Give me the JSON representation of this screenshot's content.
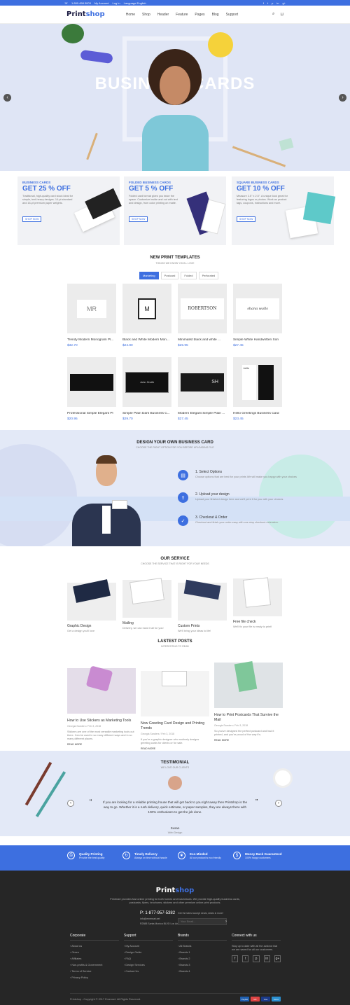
{
  "topbar": {
    "phone": "1.800.458.3003",
    "account": "My Account",
    "login": "Log In",
    "language": "Language English",
    "socials": [
      "f",
      "t",
      "p",
      "in",
      "g+"
    ]
  },
  "nav": {
    "logo_a": "Print",
    "logo_b": "shop",
    "menu": [
      "Home",
      "Shop",
      "Header",
      "Feature",
      "Pages",
      "Blog",
      "Support"
    ]
  },
  "hero": {
    "title": "BUSINESS CARDS"
  },
  "promos": [
    {
      "kicker": "BUSINESS CARDS",
      "headline": "GET 25 % OFF",
      "desc": "Traditional, high-quality card stock ideal for simple, text-heavy designs. 14-pt standard and 16-pt premium paper weights.",
      "button": "SHOP NOW"
    },
    {
      "kicker": "FOLDED BUSINESS CARDS",
      "headline": "GET 5 % OFF",
      "desc": "Folded card format gives you twice the space. Customize inside and out with text and design, from color printing on matte.",
      "button": "SHOP NOW"
    },
    {
      "kicker": "SQUARE BUSINESS CARDS",
      "headline": "GET 10 % OFF",
      "desc": "Measure 2.5\" x 2.5\". A unique look great for featuring logos or photos. Work as product tags, coupons, instructions and more.",
      "button": "SHOP NOW"
    }
  ],
  "templates": {
    "title": "NEW PRINT TEMPLATES",
    "subtitle": "THINGS WE KNOW YOU'LL LOVE",
    "tabs": [
      "Marketing",
      "Postcard",
      "Folded",
      "Perforated"
    ],
    "items": [
      {
        "name": "Trendy Modern Monogram Pl...",
        "price": "$32.70",
        "logo": "MR"
      },
      {
        "name": "Black and White Modern Mon...",
        "price": "$24.80",
        "logo": "M"
      },
      {
        "name": "Minimalist black and white ...",
        "price": "$25.95",
        "logo": "ROBERTSON"
      },
      {
        "name": "Simple White Handwritten Son",
        "price": "$27.45",
        "logo": "shana walls"
      },
      {
        "name": "Professional Simple Elegant Pl",
        "price": "$20.95",
        "logo": ""
      },
      {
        "name": "Simple Plain Dark Business C...",
        "price": "$29.70",
        "logo": "John Smith"
      },
      {
        "name": "Modern Elegant Simple Plain ...",
        "price": "$27.45",
        "logo": "SH"
      },
      {
        "name": "Hello Greetings Business Card",
        "price": "$23.45",
        "logo": "hello"
      }
    ]
  },
  "design": {
    "title": "DESIGN YOUR OWN BUSINESS CARD",
    "subtitle": "CHOOSE THE RIGHT OPTION FOR YOU BEFORE UPLOADING FILE",
    "steps": [
      {
        "title": "1. Select Options",
        "desc": "Choose options that are best for your prints We will make you happy with your choices"
      },
      {
        "title": "2. Upload your design",
        "desc": "Upload your finished design here and we'll print it for you with your choices"
      },
      {
        "title": "3. Checkout & Order",
        "desc": "Checkout and finish your order easy with one stop checkout extension."
      }
    ]
  },
  "service": {
    "title": "OUR SERVICE",
    "subtitle": "CHOOSE THE SERVICE THAT IS RIGHT FOR YOUR NEEDS",
    "items": [
      {
        "title": "Graphic Design",
        "desc": "Get a design you'll love"
      },
      {
        "title": "Mailing",
        "desc": "Delivery, we can hand it all for you!"
      },
      {
        "title": "Custom Prints",
        "desc": "We'll bring your ideas to life!"
      },
      {
        "title": "Free file check",
        "desc": "We'll fix your file is ready to print!"
      }
    ]
  },
  "posts": {
    "title": "LASTEST POSTS",
    "subtitle": "INTERESTING TO READ",
    "items": [
      {
        "title": "How to Use Stickers as Marketing Tools",
        "meta": "Georgia Sanders / Feb 3, 2018",
        "desc": "Stickers are one of the most versatile marketing tools out there. Can be used in so many different ways and in so many different places.",
        "more": "READ MORE"
      },
      {
        "title": "Now Greeting Card Design and Printing Trends",
        "meta": "Georgia Sanders / Feb 3, 2018",
        "desc": "If you're a graphic designer who routinely designs greeting cards for clients or for sale.",
        "more": "READ MORE"
      },
      {
        "title": "How to Print Postcards That Survive the Mail",
        "meta": "Georgia Sanders / Feb 3, 2018",
        "desc": "So you've designed the perfect postcard and had it printed, and you're proud of the way it's.",
        "more": "READ MORE"
      }
    ]
  },
  "testimonial": {
    "title": "TESTIMONIAL",
    "subtitle": "WE LOVE OUR CLIENTS",
    "quote": "If you are looking for a reliable printing house that will get back to you right away then Printshop is the way to go. Whether it is a rush delivery, quick estimate, or paper samples, they are always there with 100% enthusiasm to get the job done.",
    "name": "Susan",
    "role": "Web Design"
  },
  "features": [
    {
      "title": "Quality Printing",
      "desc": "Provide the best quality",
      "icon": "print-icon"
    },
    {
      "title": "Timely Delivery",
      "desc": "Always on time without hassle",
      "icon": "refresh-icon"
    },
    {
      "title": "Eco-Minded",
      "desc": "All our product is eco friendly",
      "icon": "leaf-icon"
    },
    {
      "title": "Money Back Guaranteed",
      "desc": "100% happy customers",
      "icon": "money-icon"
    }
  ],
  "footer": {
    "about": "Printmart provides fast online printing for both homes and businesses. We provide high-quality business cards, postcards, flyers, brochures, stickers and other premium online print products.",
    "phone": "P: 1-877-957-5382",
    "email": "info@emenset.net",
    "address": "R2588 Santa Monica BLVD Los Angeles",
    "newsletter": "Get the latest accept deals, deals & more!",
    "email_ph": "Your Email...",
    "cols": [
      {
        "title": "Corporate",
        "items": [
          "About us",
          "Green",
          "Affiliates",
          "Non-profits & Government",
          "Terms of Service",
          "Privacy Policy"
        ]
      },
      {
        "title": "Support",
        "items": [
          "My Account",
          "Design Guide",
          "FAQ",
          "Design Services",
          "Contact Us"
        ]
      },
      {
        "title": "Brands",
        "items": [
          "All Brands",
          "Brands 1",
          "Brands 2",
          "Brands 3",
          "Brands 4"
        ]
      }
    ],
    "connect": {
      "title": "Connect with us",
      "desc": "Stay up to date with all the actions that we are saved for all our customers.",
      "socials": [
        "f",
        "t",
        "p",
        "in",
        "g+"
      ]
    },
    "copyright": "Printshop - Copyright © 2017 Emenset. All Rights Reserved.",
    "payments": [
      "PayPal",
      "MC",
      "Visa",
      "Amex"
    ]
  }
}
